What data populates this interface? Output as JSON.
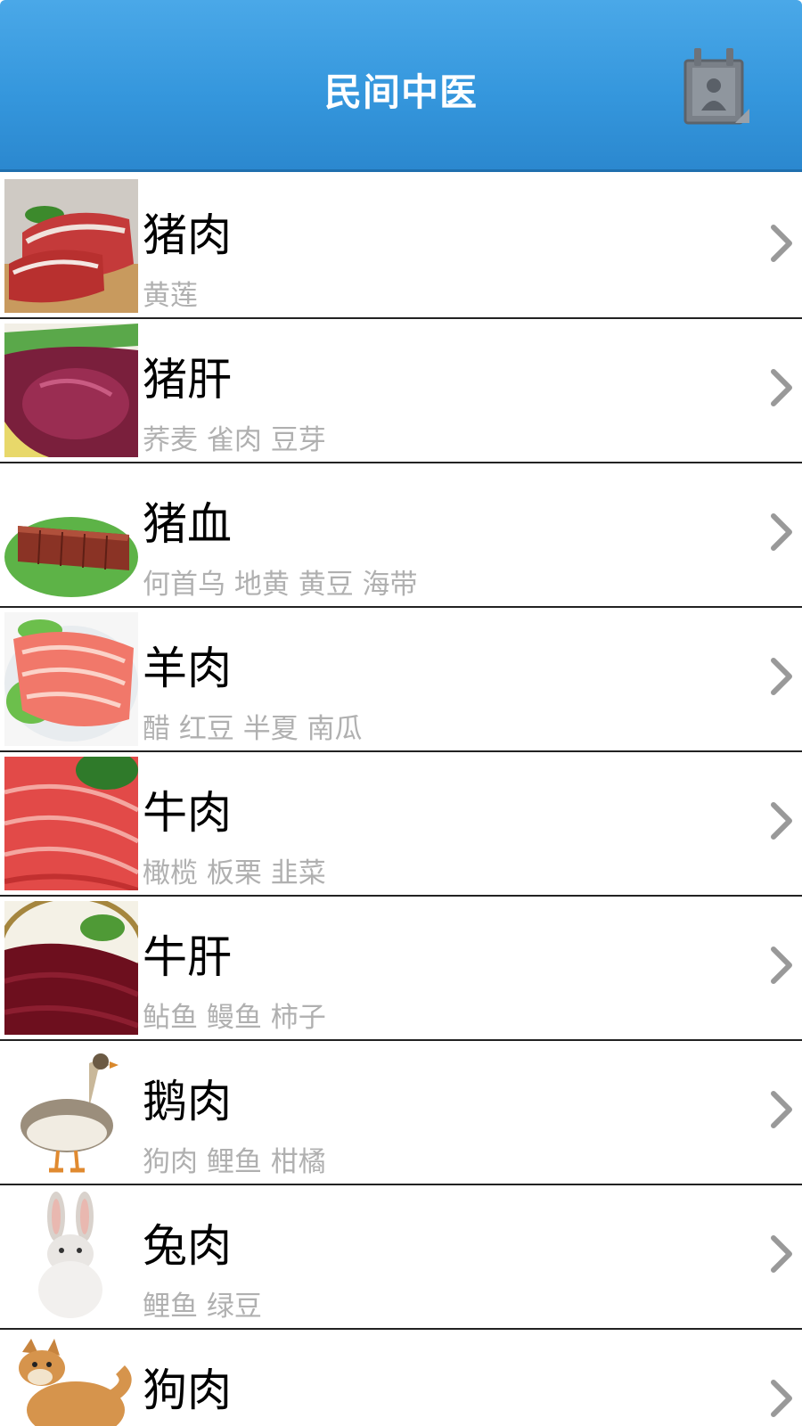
{
  "header": {
    "title": "民间中医",
    "right_icon": "contacts-calendar-icon"
  },
  "items": [
    {
      "title": "猪肉",
      "subtitle": "黄莲",
      "image": "raw-pork"
    },
    {
      "title": "猪肝",
      "subtitle": "荞麦 雀肉 豆芽",
      "image": "pork-liver"
    },
    {
      "title": "猪血",
      "subtitle": "何首乌 地黄 黄豆 海带",
      "image": "pork-blood-tofu"
    },
    {
      "title": "羊肉",
      "subtitle": "醋 红豆 半夏 南瓜",
      "image": "sliced-lamb"
    },
    {
      "title": "牛肉",
      "subtitle": "橄榄 板栗 韭菜",
      "image": "sliced-beef"
    },
    {
      "title": "牛肝",
      "subtitle": "鲇鱼 鳗鱼 柿子",
      "image": "beef-liver"
    },
    {
      "title": "鹅肉",
      "subtitle": "狗肉 鲤鱼 柑橘",
      "image": "goose"
    },
    {
      "title": "兔肉",
      "subtitle": "鲤鱼 绿豆",
      "image": "rabbit"
    },
    {
      "title": "狗肉",
      "subtitle": "",
      "image": "dog"
    }
  ]
}
